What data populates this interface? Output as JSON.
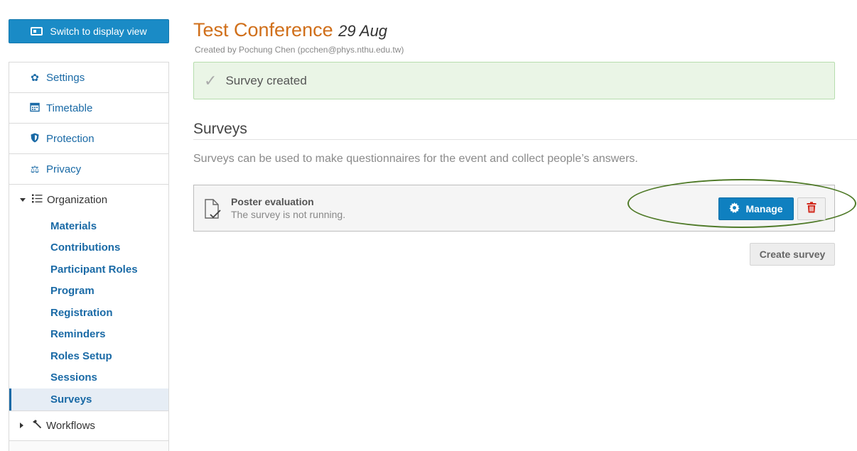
{
  "sidebar": {
    "switch_label": "Switch to display view",
    "items": [
      {
        "label": "Settings",
        "icon": "gear-icon"
      },
      {
        "label": "Timetable",
        "icon": "calendar-icon"
      },
      {
        "label": "Protection",
        "icon": "shield-icon"
      },
      {
        "label": "Privacy",
        "icon": "scales-icon"
      }
    ],
    "organization": {
      "label": "Organization",
      "sub_items": [
        "Materials",
        "Contributions",
        "Participant Roles",
        "Program",
        "Registration",
        "Reminders",
        "Roles Setup",
        "Sessions",
        "Surveys"
      ],
      "active": "Surveys"
    },
    "workflows_label": "Workflows"
  },
  "event": {
    "title": "Test Conference",
    "date": "29 Aug",
    "created_by": "Created by Pochung Chen (pcchen@phys.nthu.edu.tw)"
  },
  "alert": {
    "message": "Survey created"
  },
  "surveys": {
    "heading": "Surveys",
    "description": "Surveys can be used to make questionnaires for the event and collect people’s answers.",
    "items": [
      {
        "name": "Poster evaluation",
        "status": "The survey is not running.",
        "manage_label": "Manage"
      }
    ],
    "create_label": "Create survey"
  },
  "colors": {
    "accent": "#1a8bc6",
    "title": "#d06f1a",
    "highlight_oval": "#4f7a28",
    "delete": "#d0281c"
  }
}
